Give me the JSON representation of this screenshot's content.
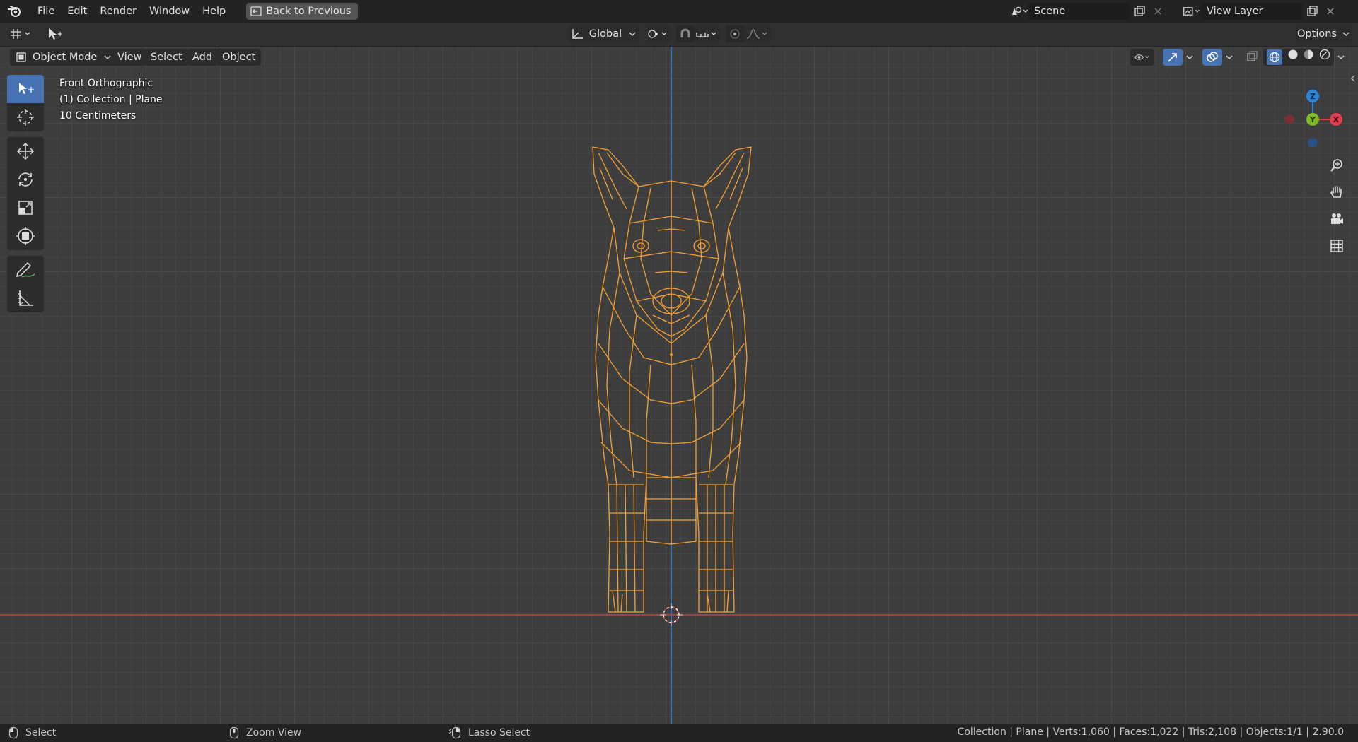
{
  "topbar": {
    "menu": [
      "File",
      "Edit",
      "Render",
      "Window",
      "Help"
    ],
    "back_button": "Back to Previous",
    "scene": "Scene",
    "view_layer": "View Layer"
  },
  "header": {
    "transform_orientation": "Global",
    "options": "Options"
  },
  "viewport_header": {
    "mode": "Object Mode",
    "menus": [
      "View",
      "Select",
      "Add",
      "Object"
    ]
  },
  "overlay_info": {
    "view_name": "Front Orthographic",
    "collection": "(1) Collection | Plane",
    "scale": "10 Centimeters"
  },
  "gizmo": {
    "z": "Z",
    "y": "Y",
    "x": "X"
  },
  "statusbar": {
    "left": "Select",
    "middle": "Zoom View",
    "right": "Lasso Select",
    "stats": "Collection | Plane | Verts:1,060 | Faces:1,022 | Tris:2,108 | Objects:1/1 | 2.90.0"
  },
  "colors": {
    "wireframe": "#f5a233",
    "x_axis": "#c84040",
    "z_axis": "#3d7fd4",
    "active_tool": "#4772b3",
    "gizmo_x": "#e23c4d",
    "gizmo_y": "#7fb920",
    "gizmo_z": "#2a86d8"
  }
}
